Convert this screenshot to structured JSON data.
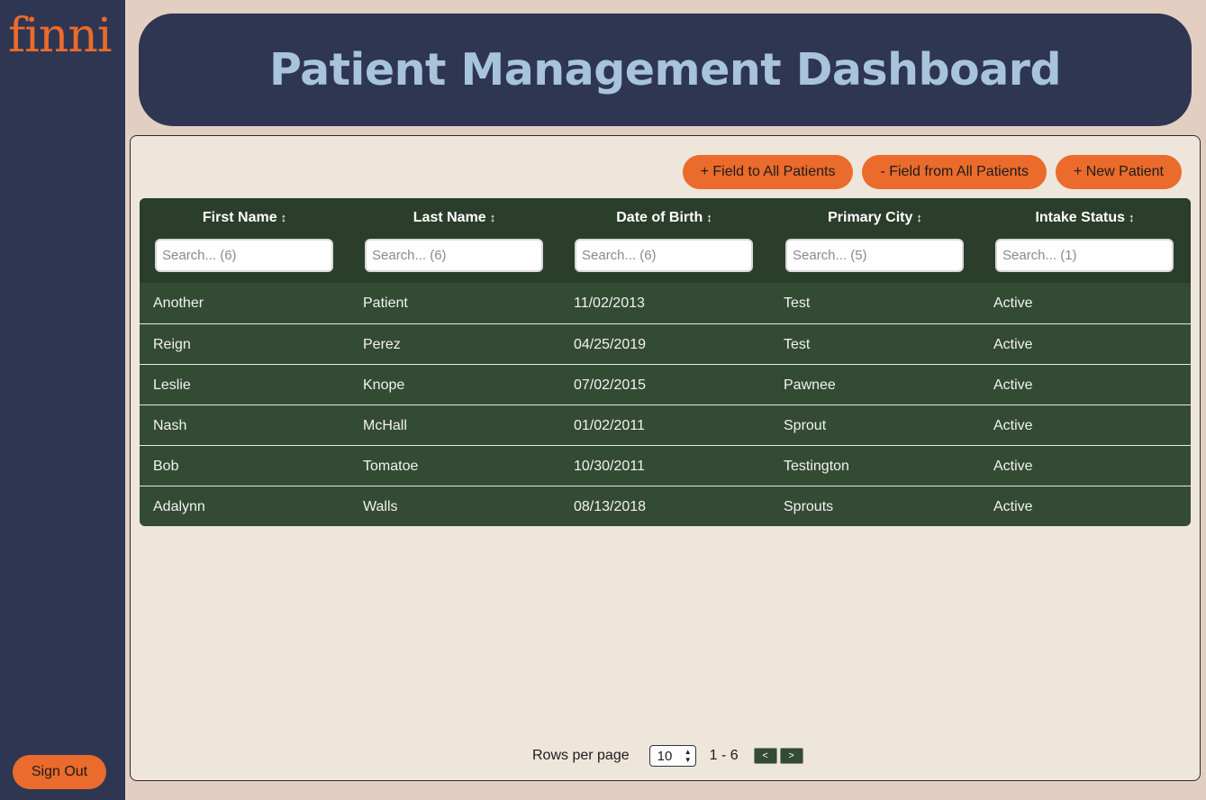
{
  "brand": {
    "logo_text": "finni",
    "logo_color": "#ea6b2b"
  },
  "sidebar": {
    "signout_label": "Sign Out"
  },
  "header": {
    "title": "Patient Management Dashboard"
  },
  "toolbar": {
    "add_field_label": "+ Field to All Patients",
    "remove_field_label": "- Field from All Patients",
    "new_patient_label": "+ New Patient"
  },
  "table": {
    "columns": [
      {
        "label": "First Name",
        "sort_icon": "⌃",
        "placeholder": "Search... (6)"
      },
      {
        "label": "Last Name",
        "sort_icon": "⌃",
        "placeholder": "Search... (6)"
      },
      {
        "label": "Date of Birth",
        "sort_icon": "⌃",
        "placeholder": "Search... (6)"
      },
      {
        "label": "Primary City",
        "sort_icon": "⌃",
        "placeholder": "Search... (5)"
      },
      {
        "label": "Intake Status",
        "sort_icon": "⌃",
        "placeholder": "Search... (1)"
      }
    ],
    "rows": [
      [
        "Another",
        "Patient",
        "11/02/2013",
        "Test",
        "Active"
      ],
      [
        "Reign",
        "Perez",
        "04/25/2019",
        "Test",
        "Active"
      ],
      [
        "Leslie",
        "Knope",
        "07/02/2015",
        "Pawnee",
        "Active"
      ],
      [
        "Nash",
        "McHall",
        "01/02/2011",
        "Sprout",
        "Active"
      ],
      [
        "Bob",
        "Tomatoe",
        "10/30/2011",
        "Testington",
        "Active"
      ],
      [
        "Adalynn",
        "Walls",
        "08/13/2018",
        "Sprouts",
        "Active"
      ]
    ]
  },
  "pagination": {
    "rows_per_page_label": "Rows per page",
    "rows_per_page_value": "10",
    "range_text": "1 - 6",
    "prev_label": "<",
    "next_label": ">"
  },
  "colors": {
    "sidebar_bg": "#2e3652",
    "accent": "#ea6b2b",
    "title_text": "#a8c4dc",
    "table_bg": "#334b33",
    "page_bg": "#e3cfc2"
  }
}
